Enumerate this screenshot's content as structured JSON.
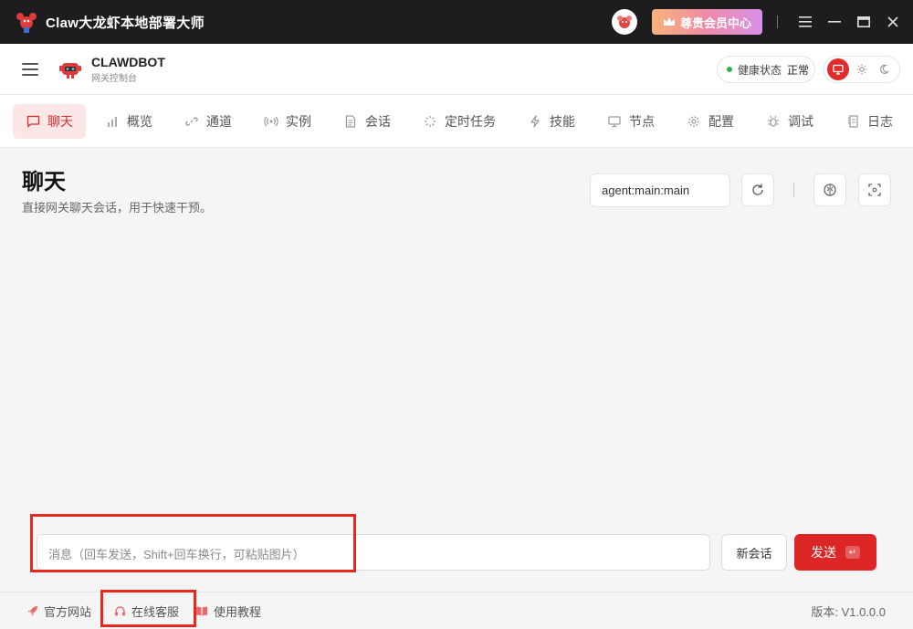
{
  "app": {
    "title": "Claw大龙虾本地部署大师",
    "vip_label": "尊贵会员中心"
  },
  "header": {
    "brand_name": "CLAWDBOT",
    "brand_sub": "网关控制台",
    "health_label": "健康状态",
    "health_value": "正常",
    "theme_options": [
      "monitor-icon",
      "sun-icon",
      "moon-icon"
    ]
  },
  "tabs": [
    {
      "label": "聊天",
      "icon": "chat-icon",
      "active": true
    },
    {
      "label": "概览",
      "icon": "bar-chart-icon"
    },
    {
      "label": "通道",
      "icon": "link-icon"
    },
    {
      "label": "实例",
      "icon": "radio-icon"
    },
    {
      "label": "会话",
      "icon": "document-icon"
    },
    {
      "label": "定时任务",
      "icon": "loader-icon"
    },
    {
      "label": "技能",
      "icon": "lightning-icon"
    },
    {
      "label": "节点",
      "icon": "monitor-icon"
    },
    {
      "label": "配置",
      "icon": "gear-icon"
    },
    {
      "label": "调试",
      "icon": "bug-icon"
    },
    {
      "label": "日志",
      "icon": "log-icon"
    }
  ],
  "main": {
    "title": "聊天",
    "subtitle": "直接网关聊天会话，用于快速干预。",
    "session_key": "agent:main:main",
    "input_placeholder": "消息（回车发送，Shift+回车换行，可粘贴图片）",
    "new_chat_label": "新会话",
    "send_label": "发送",
    "send_key": "↵"
  },
  "footer": {
    "links": [
      {
        "label": "官方网站",
        "icon": "rocket-icon"
      },
      {
        "label": "在线客服",
        "icon": "headset-icon"
      },
      {
        "label": "使用教程",
        "icon": "book-icon"
      }
    ],
    "version": "版本: V1.0.0.0"
  },
  "colors": {
    "accent": "#dc2626",
    "titlebar": "#1d1d1f",
    "highlight": "#e8281e"
  }
}
